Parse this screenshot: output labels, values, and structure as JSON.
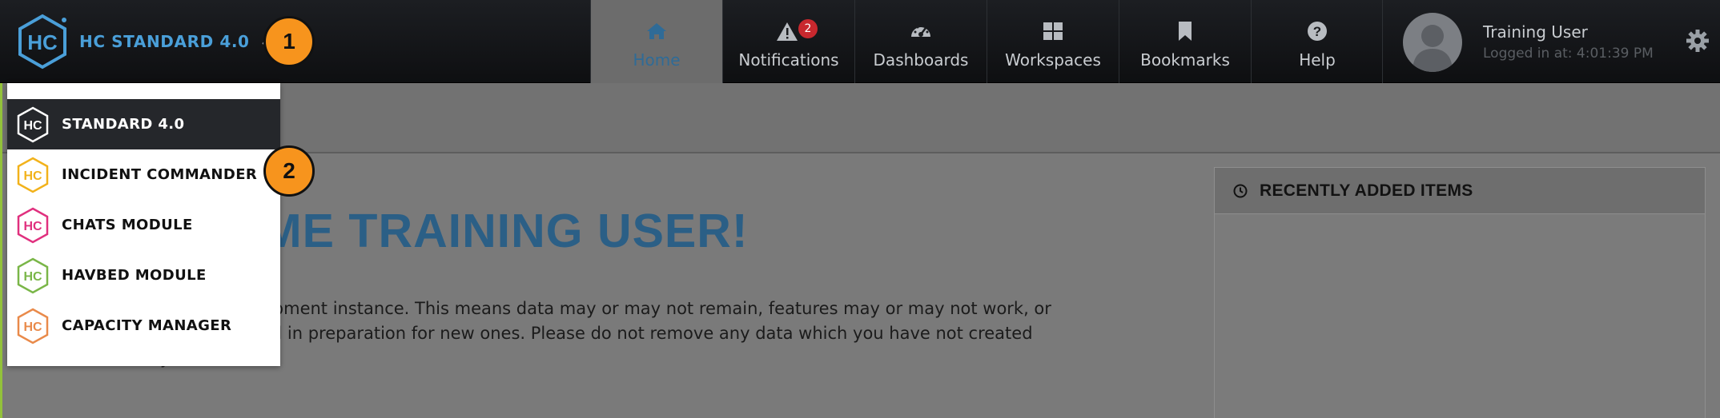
{
  "brand": {
    "title": "HC STANDARD 4.0",
    "logo_text": "HC",
    "accent": "#4a9fd9"
  },
  "nav": [
    {
      "label": "Home",
      "icon": "home-icon",
      "active": true
    },
    {
      "label": "Notifications",
      "icon": "warning-icon",
      "badge": "2"
    },
    {
      "label": "Dashboards",
      "icon": "dashboard-icon"
    },
    {
      "label": "Workspaces",
      "icon": "grid-icon"
    },
    {
      "label": "Bookmarks",
      "icon": "bookmark-icon"
    },
    {
      "label": "Help",
      "icon": "help-icon"
    }
  ],
  "user": {
    "name": "Training User",
    "login": "Logged in at: 4:01:39 PM"
  },
  "welcome": {
    "title": "LCOME TRAINING USER!",
    "line1": "active development instance. This means data may or may not remain, features may or may not work, or",
    "line2": "been removed in preparation for new ones. Please do not remove any data which you have not created",
    "line3": "y"
  },
  "recent": {
    "title": "RECENTLY ADDED ITEMS"
  },
  "dropdown": {
    "items": [
      {
        "label": "STANDARD 4.0",
        "color": "#ffffff",
        "selected": true
      },
      {
        "label": "INCIDENT COMMANDER",
        "color": "#f2b21b"
      },
      {
        "label": "CHATS MODULE",
        "color": "#e0307e"
      },
      {
        "label": "HAVBED MODULE",
        "color": "#7ab648"
      },
      {
        "label": "CAPACITY MANAGER",
        "color": "#e98a4a"
      }
    ]
  },
  "callouts": {
    "one": "1",
    "two": "2"
  }
}
